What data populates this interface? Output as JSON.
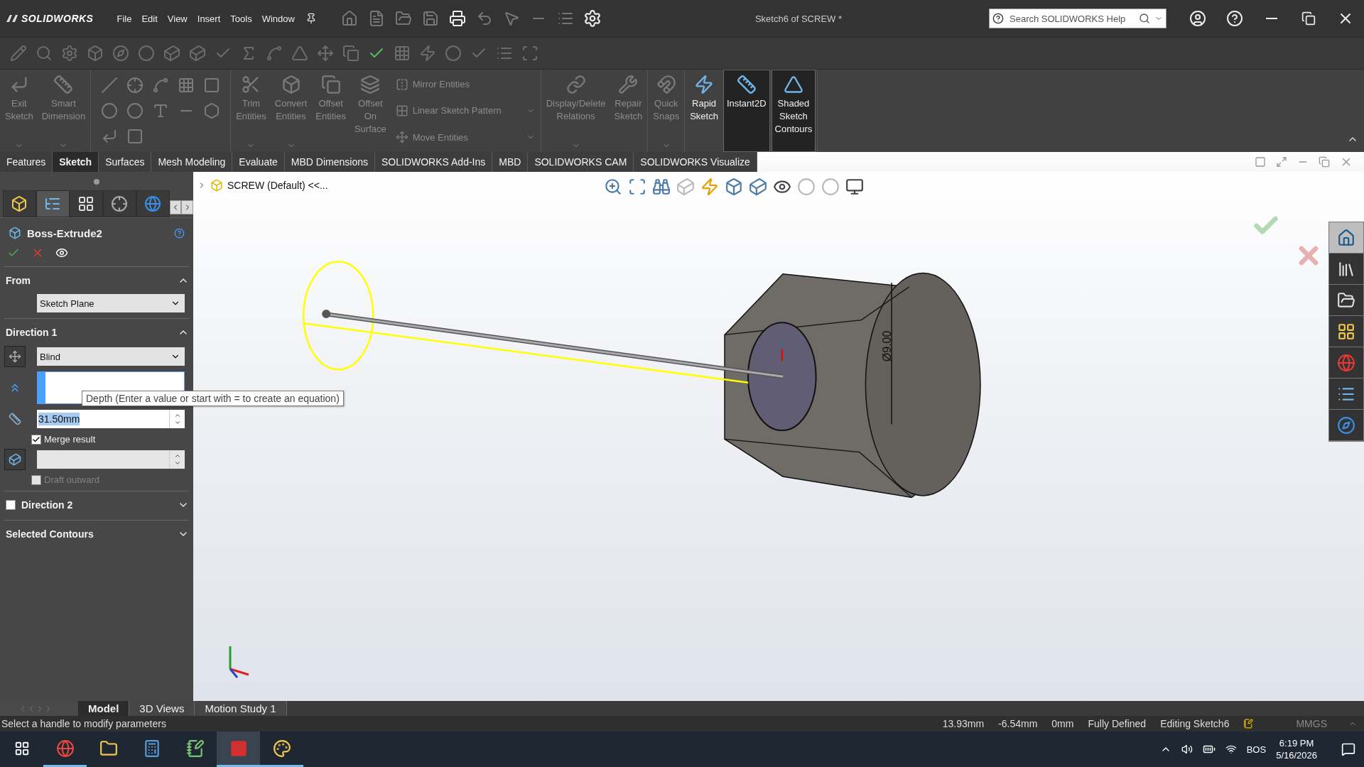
{
  "app": {
    "brand": "SOLIDWORKS",
    "menu": [
      "File",
      "Edit",
      "View",
      "Insert",
      "Tools",
      "Window"
    ],
    "document_title": "Sketch6 of SCREW *",
    "search": {
      "placeholder": "Search SOLIDWORKS Help"
    }
  },
  "ribbon": {
    "groups": [
      {
        "kind": "buttons",
        "buttons": [
          {
            "kind": "large",
            "label": "Exit Sketch",
            "disabled": true,
            "selected": false,
            "dropdown": true
          },
          {
            "kind": "large",
            "label": "Smart Dimension",
            "disabled": true,
            "selected": false,
            "dropdown": true
          }
        ]
      },
      {
        "kind": "tool_grid"
      },
      {
        "kind": "buttons",
        "buttons": [
          {
            "kind": "large",
            "label": "Trim Entities",
            "disabled": true,
            "selected": false,
            "dropdown": true
          },
          {
            "kind": "large",
            "label": "Convert Entities",
            "disabled": true,
            "selected": false,
            "dropdown": true
          },
          {
            "kind": "large",
            "label": "Offset Entities",
            "disabled": true,
            "selected": false,
            "dropdown": false
          },
          {
            "kind": "large",
            "label": "Offset On Surface",
            "disabled": true,
            "selected": false,
            "dropdown": false
          },
          {
            "kind": "small",
            "label": "Mirror Entities",
            "disabled": true,
            "selected": false,
            "dropdown": false
          },
          {
            "kind": "small",
            "label": "Linear Sketch Pattern",
            "disabled": true,
            "selected": false,
            "dropdown": true
          },
          {
            "kind": "small",
            "label": "Move Entities",
            "disabled": true,
            "selected": false,
            "dropdown": true
          }
        ]
      },
      {
        "kind": "buttons",
        "buttons": [
          {
            "kind": "large",
            "label": "Display/Delete Relations",
            "disabled": true,
            "selected": false,
            "dropdown": true
          },
          {
            "kind": "large",
            "label": "Repair Sketch",
            "disabled": true,
            "selected": false,
            "dropdown": false
          }
        ]
      },
      {
        "kind": "buttons",
        "buttons": [
          {
            "kind": "large",
            "label": "Quick Snaps",
            "disabled": true,
            "selected": false,
            "dropdown": true
          }
        ]
      },
      {
        "kind": "buttons",
        "buttons": [
          {
            "kind": "large",
            "label": "Rapid Sketch",
            "disabled": false,
            "selected": false,
            "dropdown": false
          },
          {
            "kind": "large",
            "label": "Instant2D",
            "disabled": false,
            "selected": true,
            "dropdown": false
          },
          {
            "kind": "large",
            "label": "Shaded Sketch Contours",
            "disabled": false,
            "selected": true,
            "dropdown": false
          }
        ]
      }
    ]
  },
  "tabs": [
    {
      "label": "Features",
      "selected": false
    },
    {
      "label": "Sketch",
      "selected": true
    },
    {
      "label": "Surfaces",
      "selected": false
    },
    {
      "label": "Mesh Modeling",
      "selected": false
    },
    {
      "label": "Evaluate",
      "selected": false
    },
    {
      "label": "MBD Dimensions",
      "selected": false
    },
    {
      "label": "SOLIDWORKS Add-Ins",
      "selected": false
    },
    {
      "label": "MBD",
      "selected": false
    },
    {
      "label": "SOLIDWORKS CAM",
      "selected": false
    },
    {
      "label": "SOLIDWORKS Visualize",
      "selected": false
    }
  ],
  "property_manager": {
    "panel_tabs": [
      {
        "selected": false
      },
      {
        "selected": true
      },
      {
        "selected": false
      },
      {
        "selected": false
      },
      {
        "selected": false
      }
    ],
    "title": "Boss-Extrude2",
    "sections": [
      {
        "kind": "from",
        "title": "From",
        "expanded": true,
        "start": "Sketch Plane"
      },
      {
        "kind": "direction",
        "title": "Direction 1",
        "expanded": true,
        "end_condition": "Blind",
        "depth": "31.50mm",
        "merge": {
          "label": "Merge result",
          "checked": true
        },
        "draft": {
          "label": "Draft outward",
          "checked": false,
          "disabled": true
        }
      },
      {
        "kind": "toggle",
        "title": "Direction 2",
        "checked": false,
        "expanded": false
      },
      {
        "kind": "plain",
        "title": "Selected Contours",
        "expanded": false
      }
    ]
  },
  "tooltip": "Depth (Enter a value or start with = to create an equation)",
  "viewport": {
    "tree_root": "SCREW (Default) <<...",
    "dimension": "Ø9.00"
  },
  "task_pane": [
    {
      "selected": true
    },
    {
      "selected": false
    },
    {
      "selected": false
    },
    {
      "selected": false
    },
    {
      "selected": false
    },
    {
      "selected": false
    },
    {
      "selected": false
    }
  ],
  "bottom_tabs": [
    {
      "label": "Model",
      "selected": true
    },
    {
      "label": "3D Views",
      "selected": false
    },
    {
      "label": "Motion Study 1",
      "selected": false
    }
  ],
  "status_bar": {
    "message": "Select a handle to modify parameters",
    "readings": [
      "13.93mm",
      "-6.54mm",
      "0mm",
      "Fully Defined",
      "Editing Sketch6"
    ],
    "units": "MMGS"
  },
  "taskbar": {
    "apps": [
      {
        "running": true,
        "selected": false
      },
      {
        "running": false,
        "selected": false
      },
      {
        "running": false,
        "selected": false
      },
      {
        "running": false,
        "selected": false
      },
      {
        "running": true,
        "selected": true
      },
      {
        "running": true,
        "selected": false
      }
    ],
    "language": "BOS",
    "time": "6:19 PM",
    "date": "5/16/2026"
  }
}
